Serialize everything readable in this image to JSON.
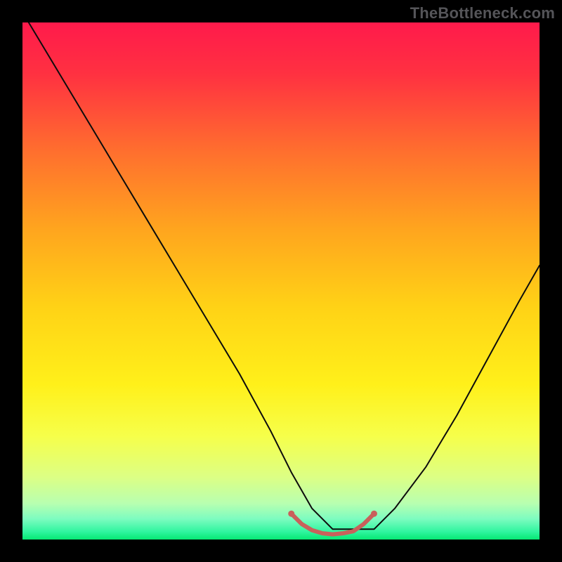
{
  "watermark": {
    "text": "TheBottleneck.com"
  },
  "chart_data": {
    "type": "line",
    "title": "",
    "xlabel": "",
    "ylabel": "",
    "xlim": [
      0,
      100
    ],
    "ylim": [
      0,
      100
    ],
    "grid": false,
    "legend": null,
    "background_gradient_stops": [
      {
        "pos": 0.0,
        "color": "#ff1a4b"
      },
      {
        "pos": 0.1,
        "color": "#ff3141"
      },
      {
        "pos": 0.25,
        "color": "#ff6f2e"
      },
      {
        "pos": 0.4,
        "color": "#ffa51e"
      },
      {
        "pos": 0.55,
        "color": "#ffd216"
      },
      {
        "pos": 0.7,
        "color": "#fff01a"
      },
      {
        "pos": 0.8,
        "color": "#f6ff4a"
      },
      {
        "pos": 0.88,
        "color": "#dcff85"
      },
      {
        "pos": 0.93,
        "color": "#b8ffb0"
      },
      {
        "pos": 0.96,
        "color": "#7dfcc0"
      },
      {
        "pos": 0.985,
        "color": "#2ff59f"
      },
      {
        "pos": 1.0,
        "color": "#06e873"
      }
    ],
    "series": [
      {
        "name": "curve",
        "color": "#0c0c0c",
        "stroke_width": 2,
        "x": [
          0,
          6,
          12,
          18,
          24,
          30,
          36,
          42,
          48,
          52,
          56,
          60,
          64,
          68,
          72,
          78,
          84,
          90,
          96,
          100
        ],
        "values": [
          102,
          92,
          82,
          72,
          62,
          52,
          42,
          32,
          21,
          13,
          6,
          2,
          2,
          2,
          6,
          14,
          24,
          35,
          46,
          53
        ]
      },
      {
        "name": "valley-highlight",
        "color": "#c9605b",
        "stroke_width": 6,
        "x": [
          52,
          54,
          56,
          58,
          60,
          62,
          64,
          66,
          68
        ],
        "values": [
          5,
          3,
          1.8,
          1.2,
          1.0,
          1.2,
          1.6,
          3,
          5
        ]
      }
    ],
    "markers": [
      {
        "name": "left-dot",
        "x": 52,
        "y": 5,
        "r": 4.5,
        "color": "#c9605b"
      },
      {
        "name": "right-dot",
        "x": 68,
        "y": 5,
        "r": 4.5,
        "color": "#c9605b"
      }
    ]
  }
}
